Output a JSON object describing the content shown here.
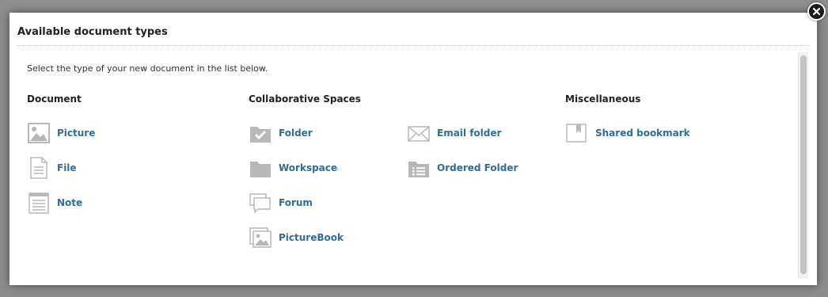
{
  "dialog": {
    "title": "Available document types",
    "intro": "Select the type of your new document in the list below."
  },
  "columns": {
    "document": {
      "heading": "Document",
      "items": [
        {
          "label": "Picture",
          "icon": "picture-icon"
        },
        {
          "label": "File",
          "icon": "file-icon"
        },
        {
          "label": "Note",
          "icon": "note-icon"
        }
      ]
    },
    "collaborative": {
      "heading": "Collaborative Spaces",
      "items": [
        {
          "label": "Folder",
          "icon": "folder-check-icon"
        },
        {
          "label": "Workspace",
          "icon": "workspace-folder-icon"
        },
        {
          "label": "Forum",
          "icon": "forum-icon"
        },
        {
          "label": "PictureBook",
          "icon": "picturebook-icon"
        },
        {
          "label": "Email folder",
          "icon": "email-folder-icon"
        },
        {
          "label": "Ordered Folder",
          "icon": "ordered-folder-icon"
        }
      ]
    },
    "misc": {
      "heading": "Miscellaneous",
      "items": [
        {
          "label": "Shared bookmark",
          "icon": "shared-bookmark-icon"
        }
      ]
    }
  },
  "colors": {
    "link": "#2a6fa0",
    "icon": "#b8b8b8",
    "close": "#1a1a1a"
  }
}
